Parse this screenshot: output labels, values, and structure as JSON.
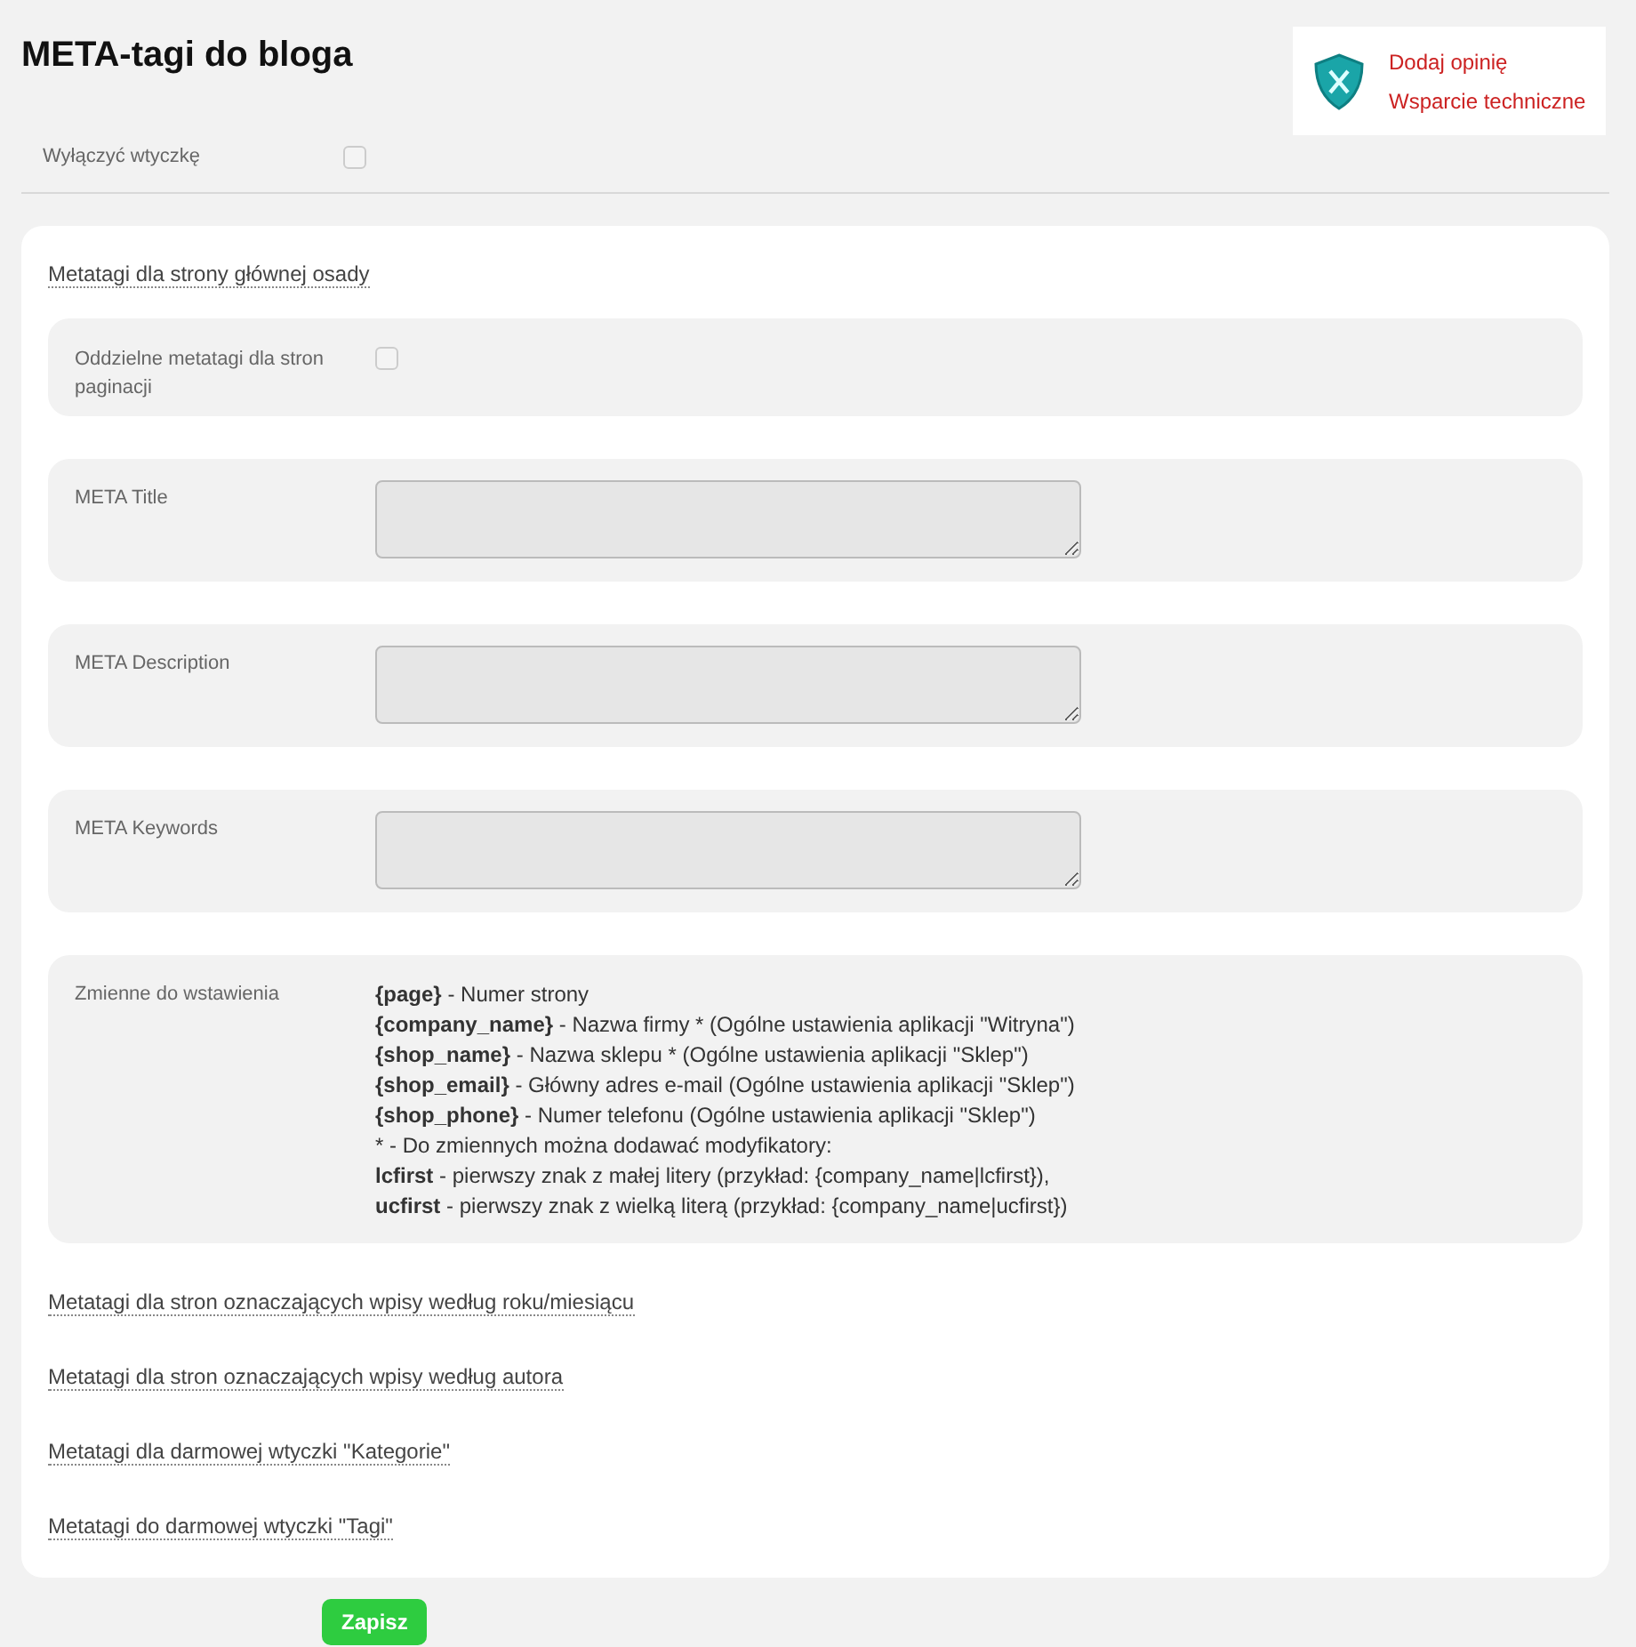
{
  "title": "META-tagi do bloga",
  "support": {
    "links": [
      "Dodaj opinię",
      "Wsparcie techniczne"
    ]
  },
  "disable_plugin": {
    "label": "Wyłączyć wtyczkę",
    "checked": false
  },
  "main_section": {
    "link": "Metatagi dla strony głównej osady",
    "rows": [
      {
        "kind": "checkbox",
        "label": "Oddzielne metatagi dla stron paginacji",
        "checked": false
      },
      {
        "kind": "textarea",
        "label": "META Title"
      },
      {
        "kind": "textarea",
        "label": "META Description"
      },
      {
        "kind": "textarea",
        "label": "META Keywords"
      },
      {
        "kind": "text",
        "label": "Zmienne do wstawienia",
        "lines": [
          "**{page}** - Numer strony",
          "**{company_name}** - Nazwa firmy * (Ogólne ustawienia aplikacji \"Witryna\")",
          "**{shop_name}** - Nazwa sklepu * (Ogólne ustawienia aplikacji \"Sklep\")",
          "**{shop_email}** - Główny adres e-mail (Ogólne ustawienia aplikacji \"Sklep\")",
          "**{shop_phone}** - Numer telefonu (Ogólne ustawienia aplikacji \"Sklep\")",
          "* - Do zmiennych można dodawać modyfikatory:",
          "**lcfirst** - pierwszy znak z małej litery (przykład: {company_name|lcfirst}),",
          "**ucfirst** - pierwszy znak z wielką literą (przykład: {company_name|ucfirst})"
        ]
      }
    ]
  },
  "other_sections": [
    "Metatagi dla stron oznaczających wpisy według roku/miesiącu",
    "Metatagi dla stron oznaczających wpisy według autora",
    "Metatagi dla darmowej wtyczki \"Kategorie\"",
    "Metatagi do darmowej wtyczki \"Tagi\""
  ],
  "save_button": "Zapisz"
}
